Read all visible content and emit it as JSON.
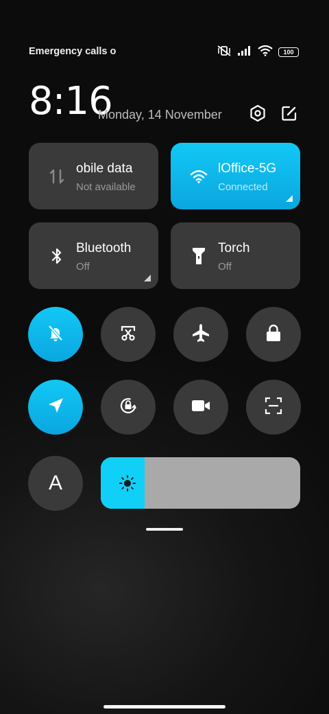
{
  "status_bar": {
    "carrier_text": "Emergency calls o",
    "battery": "100"
  },
  "header": {
    "time": "8:16",
    "date": "Monday, 14 November"
  },
  "tiles": {
    "mobile_data": {
      "label": "obile data",
      "sub": "Not available",
      "active": false
    },
    "wifi": {
      "label": "lOffice-5G",
      "sub": "Connected",
      "active": true
    },
    "bluetooth": {
      "label": "Bluetooth",
      "sub": "Off",
      "active": false
    },
    "torch": {
      "label": "Torch",
      "sub": "Off",
      "active": false
    }
  },
  "toggles": [
    {
      "icon": "mute-bell-icon",
      "active": true
    },
    {
      "icon": "screenshot-icon",
      "active": false
    },
    {
      "icon": "airplane-icon",
      "active": false
    },
    {
      "icon": "lock-icon",
      "active": false
    },
    {
      "icon": "location-icon",
      "active": true
    },
    {
      "icon": "rotation-lock-icon",
      "active": false
    },
    {
      "icon": "video-icon",
      "active": false
    },
    {
      "icon": "scanner-icon",
      "active": false
    }
  ],
  "auto_brightness": {
    "label": "A"
  },
  "brightness": {
    "level_percent": 22
  },
  "colors": {
    "accent": "#12c8f5",
    "tile_bg": "#3a3a3a",
    "slider_bg": "#a9a9a9"
  }
}
